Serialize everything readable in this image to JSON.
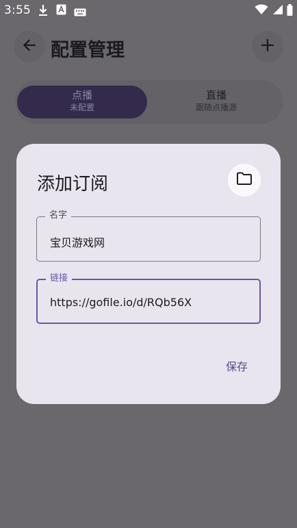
{
  "status_bar": {
    "time": "3:55",
    "icons": [
      "download-icon",
      "font-notification-icon",
      "keyboard-icon",
      "wifi-icon",
      "signal-icon",
      "battery-icon"
    ]
  },
  "app_bar": {
    "title": "配置管理",
    "back_icon": "arrow-back-icon",
    "add_icon": "plus-icon"
  },
  "segmented": {
    "items": [
      {
        "label": "点播",
        "sublabel": "未配置",
        "selected": true
      },
      {
        "label": "直播",
        "sublabel": "跟随点播源",
        "selected": false
      }
    ]
  },
  "dialog": {
    "title": "添加订阅",
    "folder_icon": "folder-icon",
    "fields": {
      "name": {
        "label": "名字",
        "value": "宝贝游戏网"
      },
      "link": {
        "label": "链接",
        "value": "https://gofile.io/d/RQb56X"
      }
    },
    "save_label": "保存"
  },
  "colors": {
    "scrim_background": "#6a686c",
    "dialog_surface": "#e9e5ee",
    "accent": "#6a55a8",
    "selected_segment": "#332a4c"
  }
}
